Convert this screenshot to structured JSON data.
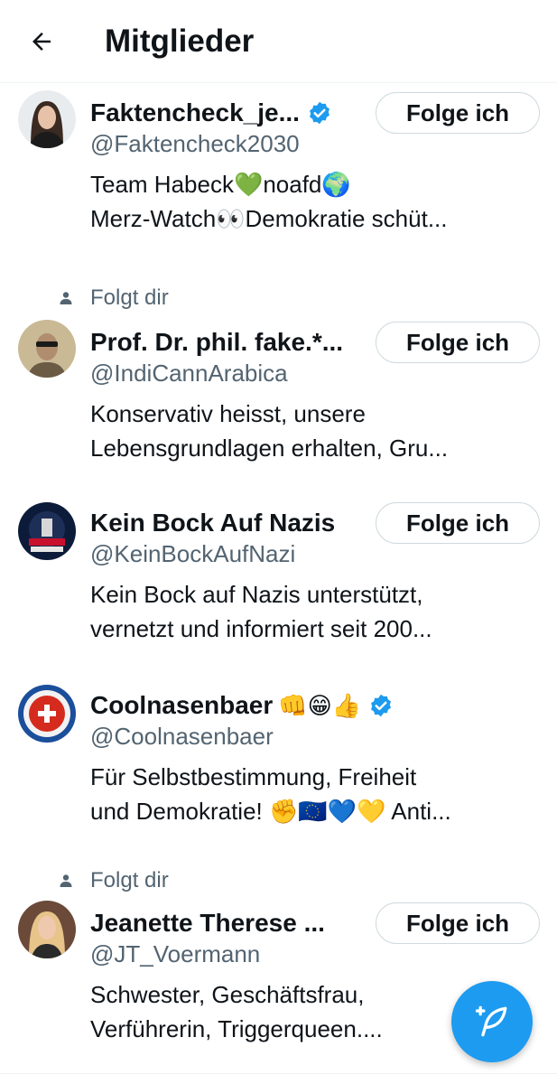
{
  "header": {
    "title": "Mitglieder",
    "back_icon": "arrow-left-icon"
  },
  "members": [
    {
      "display_name": "Faktencheck_je...",
      "verified": true,
      "emojis": "",
      "handle": "@Faktencheck2030",
      "bio_lines": [
        "Team Habeck💚noafd🌍",
        "Merz-Watch👀Demokratie schüt..."
      ],
      "follows_you": false,
      "follow_label": "Folge ich",
      "show_follow_button": true
    },
    {
      "display_name": "Prof. Dr. phil. fake.*...",
      "verified": false,
      "emojis": "",
      "handle": "@IndiCannArabica",
      "bio_lines": [
        "Konservativ heisst, unsere",
        "Lebensgrundlagen erhalten, Gru..."
      ],
      "follows_you": true,
      "follows_you_label": "Folgt dir",
      "follow_label": "Folge ich",
      "show_follow_button": true
    },
    {
      "display_name": "Kein Bock Auf Nazis",
      "verified": false,
      "emojis": "",
      "handle": "@KeinBockAufNazi",
      "bio_lines": [
        "Kein Bock auf Nazis unterstützt,",
        "vernetzt und informiert seit 200..."
      ],
      "follows_you": false,
      "follow_label": "Folge ich",
      "show_follow_button": true
    },
    {
      "display_name": "Coolnasenbaer",
      "verified": true,
      "emojis": "👊😁👍",
      "handle": "@Coolnasenbaer",
      "bio_lines": [
        "Für Selbstbestimmung, Freiheit",
        "und Demokratie! ✊🇪🇺💙💛 Anti..."
      ],
      "follows_you": false,
      "follow_label": "",
      "show_follow_button": false
    },
    {
      "display_name": "Jeanette Therese ...",
      "verified": false,
      "emojis": "",
      "handle": "@JT_Voermann",
      "bio_lines": [
        "Schwester, Geschäftsfrau,",
        "Verführerin, Triggerqueen...."
      ],
      "follows_you": true,
      "follows_you_label": "Folgt dir",
      "follow_label": "Folge ich",
      "show_follow_button": true
    }
  ],
  "fab": {
    "icon": "compose-post-icon"
  },
  "colors": {
    "accent": "#1d9bf0",
    "muted_text": "#536471",
    "text": "#0f1419",
    "border": "#cfd9de"
  }
}
